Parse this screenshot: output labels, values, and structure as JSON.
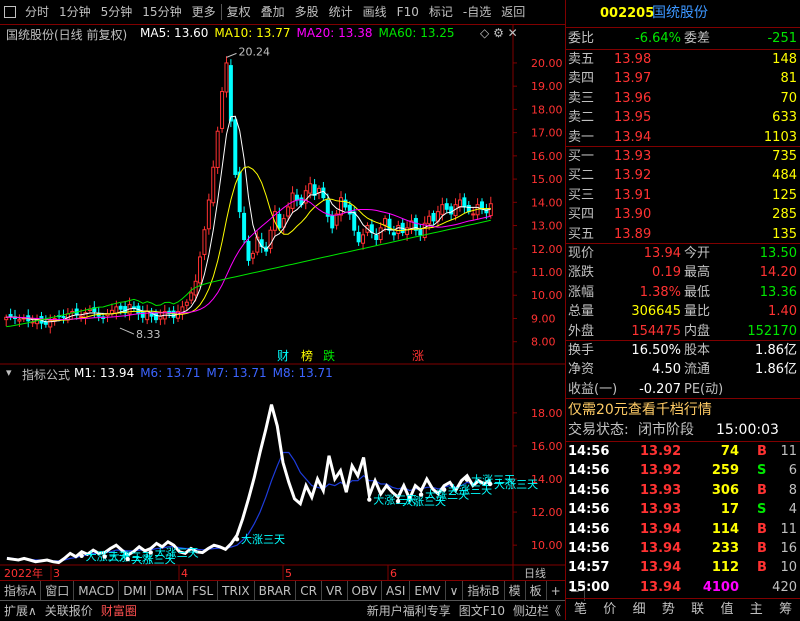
{
  "toolbar": {
    "periods": [
      "分时",
      "1分钟",
      "5分钟",
      "15分钟",
      "更多"
    ],
    "tools": [
      "复权",
      "叠加",
      "多股",
      "统计",
      "画线",
      "F10",
      "标记",
      "-自选",
      "返回"
    ]
  },
  "main_chart": {
    "title": "国统股份(日线 前复权)",
    "ma": [
      {
        "label": "MA5: 13.60",
        "color": "#ffffff"
      },
      {
        "label": "MA10: 13.77",
        "color": "#ffff00"
      },
      {
        "label": "MA20: 13.38",
        "color": "#ff00ff"
      },
      {
        "label": "MA60: 13.25",
        "color": "#00e600"
      }
    ],
    "y_ticks": [
      "20.00",
      "19.00",
      "18.00",
      "17.00",
      "16.00",
      "15.00",
      "14.00",
      "13.00",
      "12.00",
      "11.00",
      "10.00",
      "9.00",
      "8.00"
    ],
    "high_label": "20.24",
    "low_label": "8.33",
    "markers": [
      {
        "text": "财",
        "color": "#00ffff"
      },
      {
        "text": "榜",
        "color": "#ffff00"
      },
      {
        "text": "跌",
        "color": "#00e600"
      },
      {
        "text": "涨",
        "color": "#ff3232"
      }
    ]
  },
  "indicator": {
    "title": "指标公式",
    "values": [
      {
        "label": "M1: 13.94",
        "color": "#ffffff"
      },
      {
        "label": "M6: 13.71",
        "color": "#3c64ff"
      },
      {
        "label": "M7: 13.71",
        "color": "#3c64ff"
      },
      {
        "label": "M8: 13.71",
        "color": "#3c64ff"
      }
    ],
    "y_ticks": [
      "18.00",
      "16.00",
      "14.00",
      "12.00",
      "10.00"
    ],
    "signal_text": "大涨三天"
  },
  "x_axis": {
    "labels": [
      "2022年",
      "3",
      "4",
      "5",
      "6"
    ],
    "period": "日线"
  },
  "bottom_tabs": [
    "指标A",
    "窗口",
    "MACD",
    "DMI",
    "DMA",
    "FSL",
    "TRIX",
    "BRAR",
    "CR",
    "VR",
    "OBV",
    "ASI",
    "EMV",
    "∨",
    "指标B",
    "模",
    "板",
    "+",
    "−"
  ],
  "footer": {
    "left": [
      "扩展∧",
      "关联报价",
      "财富圈"
    ],
    "right": [
      "新用户福利专享",
      "图文F10",
      "侧边栏《"
    ]
  },
  "quote": {
    "code": "002205",
    "name": "国统股份",
    "weibi_label": "委比",
    "weibi": "-6.64%",
    "weicha_label": "委差",
    "weicha": "-251",
    "asks": [
      {
        "label": "卖五",
        "price": "13.98",
        "vol": "148"
      },
      {
        "label": "卖四",
        "price": "13.97",
        "vol": "81"
      },
      {
        "label": "卖三",
        "price": "13.96",
        "vol": "70"
      },
      {
        "label": "卖二",
        "price": "13.95",
        "vol": "633"
      },
      {
        "label": "卖一",
        "price": "13.94",
        "vol": "1103"
      }
    ],
    "bids": [
      {
        "label": "买一",
        "price": "13.93",
        "vol": "735"
      },
      {
        "label": "买二",
        "price": "13.92",
        "vol": "484"
      },
      {
        "label": "买三",
        "price": "13.91",
        "vol": "125"
      },
      {
        "label": "买四",
        "price": "13.90",
        "vol": "285"
      },
      {
        "label": "买五",
        "price": "13.89",
        "vol": "135"
      }
    ],
    "stats": [
      {
        "l1": "现价",
        "v1": "13.94",
        "c1": "#ff3232",
        "l2": "今开",
        "v2": "13.50",
        "c2": "#00e600"
      },
      {
        "l1": "涨跌",
        "v1": "0.19",
        "c1": "#ff3232",
        "l2": "最高",
        "v2": "14.20",
        "c2": "#ff3232"
      },
      {
        "l1": "涨幅",
        "v1": "1.38%",
        "c1": "#ff3232",
        "l2": "最低",
        "v2": "13.36",
        "c2": "#00e600"
      },
      {
        "l1": "总量",
        "v1": "306645",
        "c1": "#ffff00",
        "l2": "量比",
        "v2": "1.40",
        "c2": "#ff3232"
      },
      {
        "l1": "外盘",
        "v1": "154475",
        "c1": "#ff3232",
        "l2": "内盘",
        "v2": "152170",
        "c2": "#00e600"
      }
    ],
    "stats2": [
      {
        "l1": "换手",
        "v1": "16.50%",
        "l2": "股本",
        "v2": "1.86亿"
      },
      {
        "l1": "净资",
        "v1": "4.50",
        "l2": "流通",
        "v2": "1.86亿"
      },
      {
        "l1": "收益(一)",
        "v1": "-0.207",
        "l2": "PE(动)",
        "v2": ""
      }
    ],
    "promo": "仅需20元查看千档行情",
    "trade_status_label": "交易状态:",
    "trade_status": "闭市阶段",
    "trade_status_time": "15:00:03",
    "ticks": [
      {
        "time": "14:56",
        "price": "13.92",
        "vol": "74",
        "side": "B",
        "n": "11",
        "vc": "#ffff00"
      },
      {
        "time": "14:56",
        "price": "13.92",
        "vol": "259",
        "side": "S",
        "n": "6",
        "vc": "#ffff00"
      },
      {
        "time": "14:56",
        "price": "13.93",
        "vol": "306",
        "side": "B",
        "n": "8",
        "vc": "#ffff00"
      },
      {
        "time": "14:56",
        "price": "13.93",
        "vol": "17",
        "side": "S",
        "n": "4",
        "vc": "#ffff00"
      },
      {
        "time": "14:56",
        "price": "13.94",
        "vol": "114",
        "side": "B",
        "n": "11",
        "vc": "#ffff00"
      },
      {
        "time": "14:56",
        "price": "13.94",
        "vol": "233",
        "side": "B",
        "n": "16",
        "vc": "#ffff00"
      },
      {
        "time": "14:57",
        "price": "13.94",
        "vol": "112",
        "side": "B",
        "n": "10",
        "vc": "#ffff00"
      },
      {
        "time": "15:00",
        "price": "13.94",
        "vol": "4100",
        "side": "",
        "n": "420",
        "vc": "#ff00ff"
      }
    ],
    "tabs": [
      "笔",
      "价",
      "细",
      "势",
      "联",
      "值",
      "主",
      "筹"
    ]
  },
  "chart_data": {
    "type": "candlestick",
    "ylim": [
      7.6,
      20.6
    ],
    "x_month_ticks": [
      {
        "label": "3",
        "index": 16
      },
      {
        "label": "4",
        "index": 54
      },
      {
        "label": "5",
        "index": 86
      },
      {
        "label": "6",
        "index": 116
      }
    ],
    "series": [
      {
        "name": "MA5",
        "color": "#ffffff"
      },
      {
        "name": "MA10",
        "color": "#ffff00"
      },
      {
        "name": "MA20",
        "color": "#ff00ff"
      },
      {
        "name": "MA60",
        "color": "#00e600"
      }
    ],
    "close": [
      9.05,
      9.1,
      9.0,
      8.95,
      9.02,
      8.9,
      8.85,
      8.98,
      8.8,
      8.75,
      8.9,
      9.0,
      9.1,
      9.05,
      9.2,
      9.3,
      9.15,
      9.1,
      9.25,
      9.4,
      9.3,
      9.1,
      9.0,
      9.2,
      9.35,
      9.5,
      9.4,
      9.25,
      9.6,
      9.45,
      9.2,
      9.05,
      9.3,
      9.1,
      8.95,
      9.1,
      9.3,
      9.2,
      9.05,
      9.3,
      9.5,
      9.7,
      10.1,
      10.6,
      11.65,
      12.82,
      14.1,
      15.51,
      17.06,
      18.77,
      20.0,
      17.5,
      15.2,
      13.6,
      12.4,
      11.5,
      11.8,
      12.5,
      12.1,
      11.9,
      12.8,
      13.6,
      12.9,
      13.3,
      13.8,
      14.4,
      14.1,
      13.9,
      14.5,
      14.8,
      14.3,
      14.6,
      14.2,
      13.4,
      12.9,
      13.5,
      14.2,
      13.8,
      13.5,
      12.8,
      12.3,
      12.6,
      13.0,
      12.7,
      12.4,
      12.9,
      13.3,
      12.8,
      12.6,
      13.0,
      12.7,
      12.9,
      13.2,
      12.8,
      12.6,
      13.1,
      13.4,
      13.2,
      13.6,
      13.9,
      13.7,
      13.5,
      13.9,
      14.1,
      13.8,
      13.6,
      13.5,
      13.9,
      13.7,
      13.55,
      13.94
    ],
    "ind_ylim": [
      8.8,
      19.2
    ],
    "ind_m1": [
      9.2,
      9.15,
      9.1,
      9.2,
      9.1,
      9.0,
      9.05,
      9.1,
      9.0,
      8.95,
      9.2,
      9.5,
      9.3,
      9.6,
      9.45,
      9.7,
      9.5,
      9.55,
      9.8,
      10.0,
      9.7,
      9.4,
      9.6,
      9.9,
      9.65,
      9.8,
      10.1,
      9.9,
      10.2,
      10.0,
      9.6,
      9.5,
      9.8,
      9.6,
      9.55,
      9.8,
      10.0,
      9.9,
      9.75,
      10.1,
      10.6,
      11.6,
      12.8,
      14.1,
      15.6,
      17.0,
      18.5,
      17.2,
      15.0,
      13.8,
      12.8,
      12.5,
      13.6,
      12.9,
      14.0,
      13.3,
      15.4,
      14.0,
      14.5,
      13.2,
      14.8,
      14.2,
      15.3,
      13.0,
      13.9,
      13.1,
      13.6,
      13.2,
      12.9,
      13.6,
      12.8,
      13.6,
      13.3,
      14.0,
      13.4,
      13.1,
      13.6,
      13.8,
      13.3,
      13.9,
      14.2,
      13.6,
      13.9,
      13.7,
      13.94
    ],
    "ind_m6": [
      9.25,
      9.2,
      9.15,
      9.15,
      9.15,
      9.1,
      9.1,
      9.1,
      9.05,
      9.05,
      9.1,
      9.2,
      9.25,
      9.35,
      9.4,
      9.5,
      9.5,
      9.55,
      9.6,
      9.7,
      9.7,
      9.65,
      9.65,
      9.7,
      9.7,
      9.72,
      9.8,
      9.82,
      9.9,
      9.92,
      9.85,
      9.8,
      9.8,
      9.75,
      9.72,
      9.75,
      9.8,
      9.82,
      9.8,
      9.88,
      10.0,
      10.3,
      10.7,
      11.3,
      12.0,
      12.9,
      13.9,
      14.8,
      15.6,
      15.6,
      15.1,
      14.4,
      14.0,
      13.6,
      13.5,
      13.4,
      13.7,
      13.6,
      13.8,
      13.6,
      13.9,
      13.9,
      14.2,
      13.9,
      13.9,
      13.7,
      13.7,
      13.5,
      13.4,
      13.5,
      13.3,
      13.4,
      13.4,
      13.5,
      13.5,
      13.4,
      13.5,
      13.6,
      13.5,
      13.6,
      13.8,
      13.7,
      13.8,
      13.75,
      13.71
    ]
  }
}
